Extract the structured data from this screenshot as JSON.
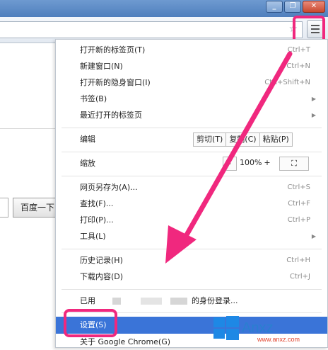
{
  "window": {
    "minimize_glyph": "_",
    "restore_glyph": "❐",
    "close_glyph": "✕"
  },
  "toolbar": {
    "star_glyph": "☆"
  },
  "page": {
    "baidu_button_label": "百度一下"
  },
  "menu": {
    "items": [
      {
        "label": "打开新的标签页(T)",
        "shortcut": "Ctrl+T"
      },
      {
        "label": "新建窗口(N)",
        "shortcut": "Ctrl+N"
      },
      {
        "label": "打开新的隐身窗口(I)",
        "shortcut": "Ctrl+Shift+N"
      },
      {
        "label": "书签(B)",
        "shortcut": ""
      },
      {
        "label": "最近打开的标签页",
        "shortcut": ""
      }
    ],
    "edit": {
      "label": "编辑",
      "cut": "剪切(T)",
      "copy": "复制(C)",
      "paste": "粘贴(P)"
    },
    "zoom": {
      "label": "缩放",
      "minus": "-",
      "value": "100%",
      "plus": "+",
      "fullscreen": "⛶"
    },
    "items2": [
      {
        "label": "网页另存为(A)...",
        "shortcut": "Ctrl+S"
      },
      {
        "label": "查找(F)...",
        "shortcut": "Ctrl+F"
      },
      {
        "label": "打印(P)...",
        "shortcut": "Ctrl+P"
      },
      {
        "label": "工具(L)",
        "shortcut": ""
      }
    ],
    "items3": [
      {
        "label": "历史记录(H)",
        "shortcut": "Ctrl+H"
      },
      {
        "label": "下载内容(D)",
        "shortcut": "Ctrl+J"
      }
    ],
    "signin": {
      "prefix": "已用",
      "suffix": "的身份登录..."
    },
    "settings": "设置(S)",
    "about": "关于 Google Chrome(G)",
    "submenu_arrow": "▶"
  },
  "watermark": {
    "text": "Anxz",
    "sub": "www.anxz.com"
  }
}
